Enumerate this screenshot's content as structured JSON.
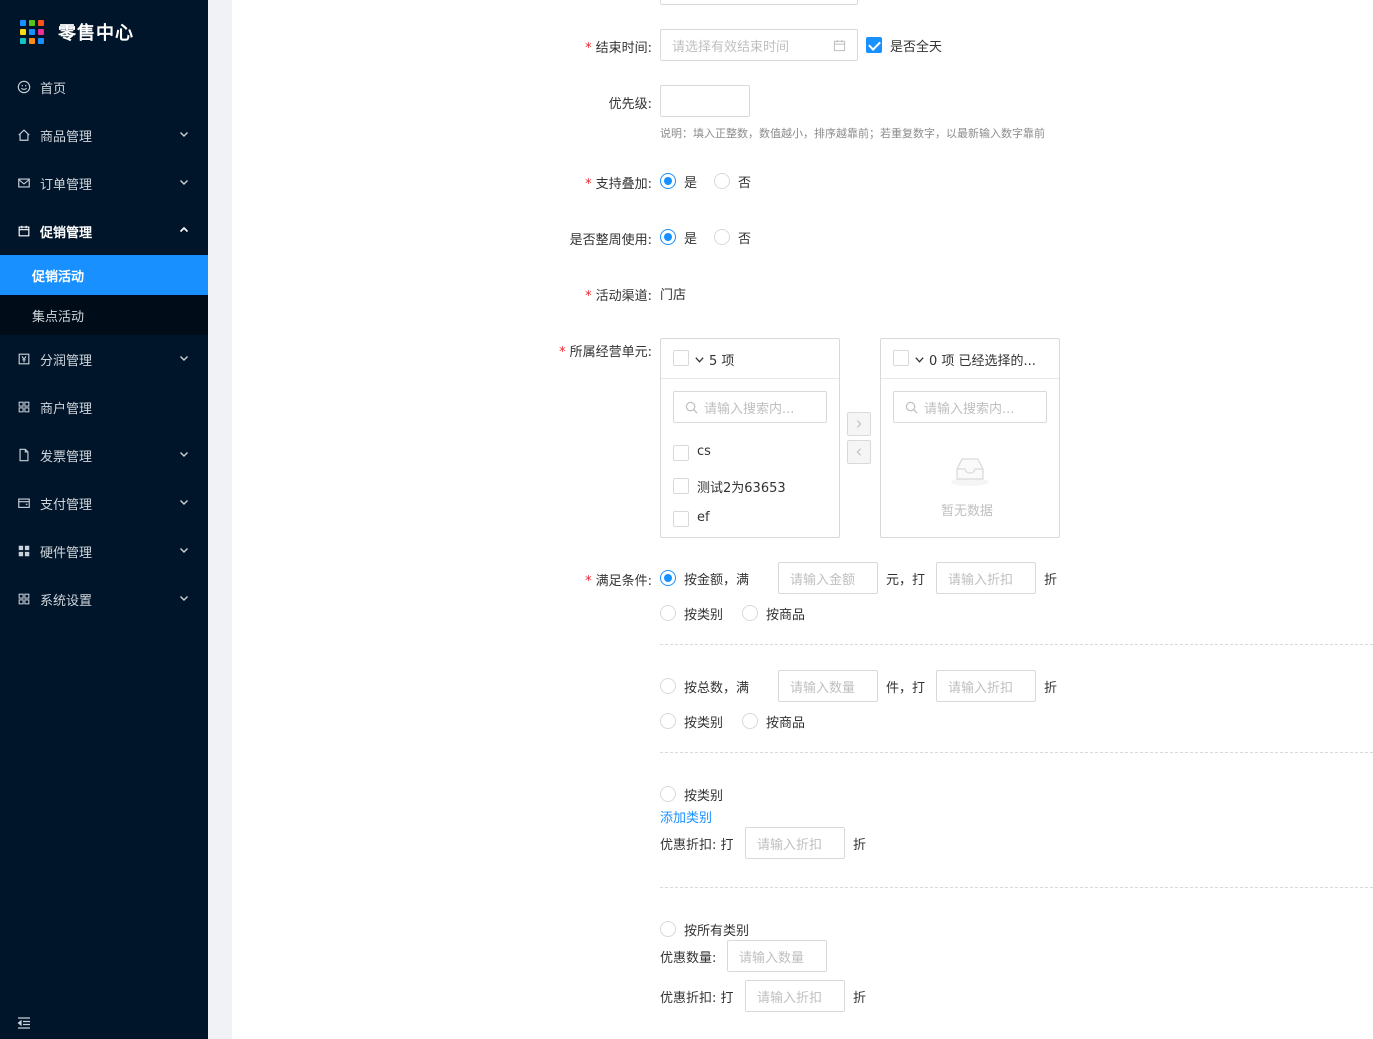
{
  "app": {
    "title": "零售中心"
  },
  "sidebar": {
    "items": [
      {
        "label": "首页"
      },
      {
        "label": "商品管理"
      },
      {
        "label": "订单管理"
      },
      {
        "label": "促销管理"
      },
      {
        "label": "分润管理"
      },
      {
        "label": "商户管理"
      },
      {
        "label": "发票管理"
      },
      {
        "label": "支付管理"
      },
      {
        "label": "硬件管理"
      },
      {
        "label": "系统设置"
      }
    ],
    "sub_items": [
      {
        "label": "促销活动",
        "active": true
      },
      {
        "label": "集点活动",
        "active": false
      }
    ]
  },
  "form": {
    "end_time": {
      "label": "结束时间:",
      "placeholder": "请选择有效结束时间",
      "allday_label": "是否全天",
      "allday_checked": true
    },
    "priority": {
      "label": "优先级:",
      "value": "",
      "hint": "说明：填入正整数，数值越小，排序越靠前；若重复数字，以最新输入数字靠前"
    },
    "stackable": {
      "label": "支持叠加:",
      "options": [
        "是",
        "否"
      ],
      "selected": "是"
    },
    "whole_week": {
      "label": "是否整周使用:",
      "options": [
        "是",
        "否"
      ],
      "selected": "是"
    },
    "channel": {
      "label": "活动渠道:",
      "value": "门店"
    },
    "business_unit": {
      "label": "所属经营单元:",
      "left": {
        "count_text": "5 项",
        "search_placeholder": "请输入搜索内...",
        "items": [
          "cs",
          "测试2为63653",
          "ef"
        ]
      },
      "right": {
        "count_text": "0 项 已经选择的...",
        "search_placeholder": "请输入搜索内...",
        "empty_text": "暂无数据"
      }
    },
    "condition": {
      "label": "满足条件:",
      "amount": {
        "prefix": "按金额，满",
        "placeholder1": "请输入金额",
        "mid": "元，打",
        "placeholder2": "请输入折扣",
        "suffix": "折",
        "checked": true
      },
      "amount_scope": {
        "opt1": "按类别",
        "opt2": "按商品"
      },
      "count": {
        "prefix": "按总数，满",
        "placeholder1": "请输入数量",
        "mid": "件，打",
        "placeholder2": "请输入折扣",
        "suffix": "折",
        "checked": false
      },
      "count_scope": {
        "opt1": "按类别",
        "opt2": "按商品"
      },
      "by_category": {
        "label": "按类别",
        "add_link": "添加类别",
        "discount_label": "优惠折扣: 打",
        "placeholder": "请输入折扣",
        "suffix": "折"
      },
      "all_category": {
        "label": "按所有类别",
        "qty_label": "优惠数量:",
        "qty_placeholder": "请输入数量",
        "discount_label": "优惠折扣: 打",
        "discount_placeholder": "请输入折扣",
        "suffix": "折"
      }
    }
  },
  "colors": {
    "sidebar_bg": "#001529",
    "submenu_bg": "#000c17",
    "accent": "#1890ff",
    "required": "#f5222d"
  }
}
